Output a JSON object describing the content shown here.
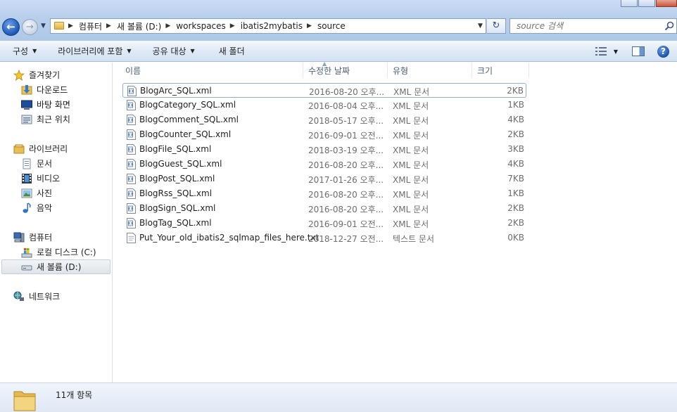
{
  "titlebar": {
    "breadcrumb": [
      "컴퓨터",
      "새 볼륨 (D:)",
      "workspaces",
      "ibatis2mybatis",
      "source"
    ],
    "search_placeholder": "source 검색"
  },
  "toolbar": {
    "organize": "구성",
    "include_library": "라이브러리에 포함",
    "share_with": "공유 대상",
    "new_folder": "새 폴더"
  },
  "sidebar": {
    "favorites": {
      "label": "즐겨찾기",
      "items": [
        "다운로드",
        "바탕 화면",
        "최근 위치"
      ]
    },
    "libraries": {
      "label": "라이브러리",
      "items": [
        "문서",
        "비디오",
        "사진",
        "음악"
      ]
    },
    "computer": {
      "label": "컴퓨터",
      "items": [
        "로컬 디스크 (C:)",
        "새 볼륨 (D:)"
      ]
    },
    "network": {
      "label": "네트워크"
    }
  },
  "columns": {
    "name": "이름",
    "modified": "수정한 날짜",
    "type": "유형",
    "size": "크기"
  },
  "files": [
    {
      "name": "BlogArc_SQL.xml",
      "date": "2016-08-20 오후...",
      "type": "XML 문서",
      "size": "2KB"
    },
    {
      "name": "BlogCategory_SQL.xml",
      "date": "2016-08-04 오후...",
      "type": "XML 문서",
      "size": "1KB"
    },
    {
      "name": "BlogComment_SQL.xml",
      "date": "2018-05-17 오후...",
      "type": "XML 문서",
      "size": "4KB"
    },
    {
      "name": "BlogCounter_SQL.xml",
      "date": "2016-09-01 오전...",
      "type": "XML 문서",
      "size": "2KB"
    },
    {
      "name": "BlogFile_SQL.xml",
      "date": "2018-03-19 오후...",
      "type": "XML 문서",
      "size": "3KB"
    },
    {
      "name": "BlogGuest_SQL.xml",
      "date": "2016-08-20 오후...",
      "type": "XML 문서",
      "size": "4KB"
    },
    {
      "name": "BlogPost_SQL.xml",
      "date": "2017-01-26 오후...",
      "type": "XML 문서",
      "size": "7KB"
    },
    {
      "name": "BlogRss_SQL.xml",
      "date": "2016-08-20 오후...",
      "type": "XML 문서",
      "size": "1KB"
    },
    {
      "name": "BlogSign_SQL.xml",
      "date": "2016-08-20 오후...",
      "type": "XML 문서",
      "size": "2KB"
    },
    {
      "name": "BlogTag_SQL.xml",
      "date": "2016-09-01 오전...",
      "type": "XML 문서",
      "size": "2KB"
    },
    {
      "name": "Put_Your_old_ibatis2_sqlmap_files_here.txt",
      "date": "2018-12-27 오전...",
      "type": "텍스트 문서",
      "size": "0KB"
    }
  ],
  "status": {
    "item_count": "11개 항목"
  },
  "colors": {
    "accent": "#1c56b8",
    "selection_border": "#8ab1d8",
    "chrome": "#d3e2f3"
  }
}
